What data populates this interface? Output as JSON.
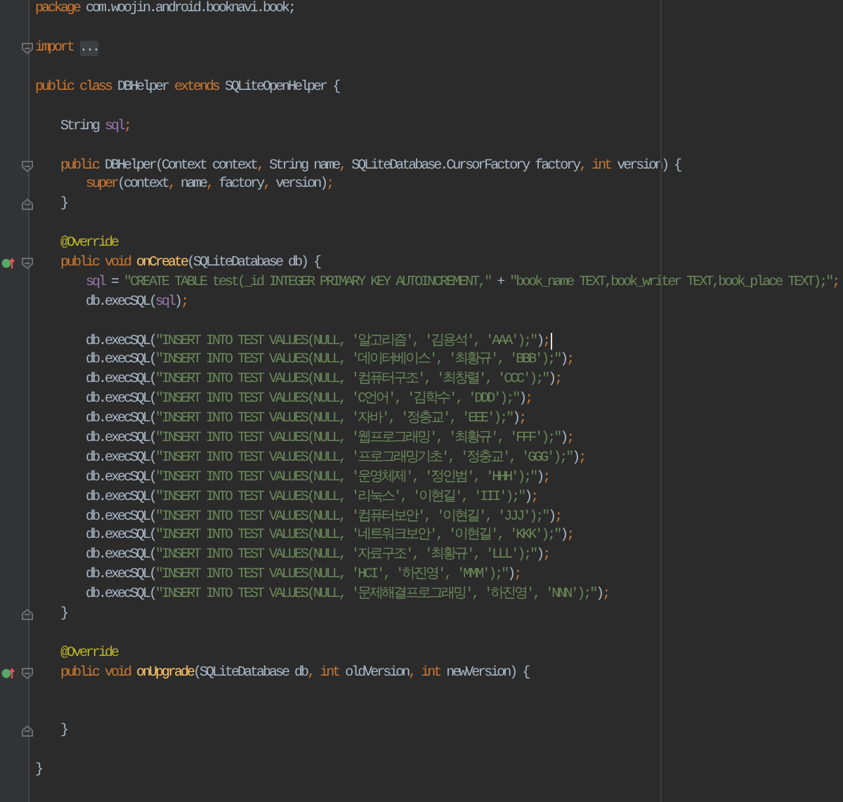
{
  "editor": {
    "lines": [
      {
        "kind": "code",
        "tokens": [
          {
            "kind": "keyword",
            "text": "package"
          },
          {
            "kind": "plain",
            "text": " com.woojin.android.booknavi.book;"
          }
        ]
      },
      {
        "kind": "blank"
      },
      {
        "kind": "code",
        "fold_open": true,
        "tokens": [
          {
            "kind": "keyword",
            "text": "import "
          },
          {
            "kind": "folded",
            "text": "..."
          }
        ]
      },
      {
        "kind": "blank"
      },
      {
        "kind": "code",
        "tokens": [
          {
            "kind": "keyword",
            "text": "public class "
          },
          {
            "kind": "plain",
            "text": "DBHelper "
          },
          {
            "kind": "keyword",
            "text": "extends "
          },
          {
            "kind": "plain",
            "text": "SQLiteOpenHelper {"
          }
        ]
      },
      {
        "kind": "blank"
      },
      {
        "kind": "code",
        "tokens": [
          {
            "kind": "plain",
            "text": "    String "
          },
          {
            "kind": "field",
            "text": "sql"
          },
          {
            "kind": "keyword",
            "text": ";"
          }
        ]
      },
      {
        "kind": "blank"
      },
      {
        "kind": "code",
        "fold_open": true,
        "tokens": [
          {
            "kind": "keyword",
            "text": "    public "
          },
          {
            "kind": "plain",
            "text": "DBHelper(Context context"
          },
          {
            "kind": "keyword",
            "text": ", "
          },
          {
            "kind": "plain",
            "text": "String name"
          },
          {
            "kind": "keyword",
            "text": ", "
          },
          {
            "kind": "plain",
            "text": "SQLiteDatabase.CursorFactory factory"
          },
          {
            "kind": "keyword",
            "text": ", int "
          },
          {
            "kind": "plain",
            "text": "version) {"
          }
        ]
      },
      {
        "kind": "code",
        "tokens": [
          {
            "kind": "keyword",
            "text": "        super"
          },
          {
            "kind": "plain",
            "text": "(context"
          },
          {
            "kind": "keyword",
            "text": ", "
          },
          {
            "kind": "plain",
            "text": "name"
          },
          {
            "kind": "keyword",
            "text": ", "
          },
          {
            "kind": "plain",
            "text": "factory"
          },
          {
            "kind": "keyword",
            "text": ", "
          },
          {
            "kind": "plain",
            "text": "version)"
          },
          {
            "kind": "keyword",
            "text": ";"
          }
        ]
      },
      {
        "kind": "code",
        "fold_close": true,
        "tokens": [
          {
            "kind": "plain",
            "text": "    }"
          }
        ]
      },
      {
        "kind": "blank"
      },
      {
        "kind": "code",
        "tokens": [
          {
            "kind": "annotation",
            "text": "    @Override"
          }
        ]
      },
      {
        "kind": "code",
        "fold_open": true,
        "override": true,
        "tokens": [
          {
            "kind": "keyword",
            "text": "    public void "
          },
          {
            "kind": "method",
            "text": "onCreate"
          },
          {
            "kind": "plain",
            "text": "(SQLiteDatabase db) {"
          }
        ]
      },
      {
        "kind": "code",
        "tokens": [
          {
            "kind": "field",
            "text": "        sql"
          },
          {
            "kind": "plain",
            "text": " = "
          },
          {
            "kind": "string",
            "text": "\"CREATE TABLE test(_id INTEGER PRIMARY KEY AUTOINCREMENT,\""
          },
          {
            "kind": "plain",
            "text": " + "
          },
          {
            "kind": "string",
            "text": "\"book_name TEXT,book_writer TEXT,book_place TEXT);\""
          },
          {
            "kind": "keyword",
            "text": ";"
          }
        ]
      },
      {
        "kind": "code",
        "tokens": [
          {
            "kind": "plain",
            "text": "        db.execSQL("
          },
          {
            "kind": "field",
            "text": "sql"
          },
          {
            "kind": "plain",
            "text": ")"
          },
          {
            "kind": "keyword",
            "text": ";"
          }
        ]
      },
      {
        "kind": "blank"
      },
      {
        "kind": "code",
        "cursor": true,
        "tokens": [
          {
            "kind": "plain",
            "text": "        db.execSQL("
          },
          {
            "kind": "string",
            "text": "\"INSERT INTO TEST VALUES(NULL, '알고리즘', '김용석', 'AAA');\""
          },
          {
            "kind": "plain",
            "text": ")"
          },
          {
            "kind": "keyword",
            "text": ";"
          }
        ]
      },
      {
        "kind": "code",
        "tokens": [
          {
            "kind": "plain",
            "text": "        db.execSQL("
          },
          {
            "kind": "string",
            "text": "\"INSERT INTO TEST VALUES(NULL, '데이터베이스', '최황규', 'BBB');\""
          },
          {
            "kind": "plain",
            "text": ")"
          },
          {
            "kind": "keyword",
            "text": ";"
          }
        ]
      },
      {
        "kind": "code",
        "tokens": [
          {
            "kind": "plain",
            "text": "        db.execSQL("
          },
          {
            "kind": "string",
            "text": "\"INSERT INTO TEST VALUES(NULL, '컴퓨터구조', '최창렬', 'CCC');\""
          },
          {
            "kind": "plain",
            "text": ")"
          },
          {
            "kind": "keyword",
            "text": ";"
          }
        ]
      },
      {
        "kind": "code",
        "tokens": [
          {
            "kind": "plain",
            "text": "        db.execSQL("
          },
          {
            "kind": "string",
            "text": "\"INSERT INTO TEST VALUES(NULL, 'C언어', '김학수', 'DDD');\""
          },
          {
            "kind": "plain",
            "text": ")"
          },
          {
            "kind": "keyword",
            "text": ";"
          }
        ]
      },
      {
        "kind": "code",
        "tokens": [
          {
            "kind": "plain",
            "text": "        db.execSQL("
          },
          {
            "kind": "string",
            "text": "\"INSERT INTO TEST VALUES(NULL, '자바', '정충교', 'EEE');\""
          },
          {
            "kind": "plain",
            "text": ")"
          },
          {
            "kind": "keyword",
            "text": ";"
          }
        ]
      },
      {
        "kind": "code",
        "tokens": [
          {
            "kind": "plain",
            "text": "        db.execSQL("
          },
          {
            "kind": "string",
            "text": "\"INSERT INTO TEST VALUES(NULL, '웹프로그래밍', '최황규', 'FFF');\""
          },
          {
            "kind": "plain",
            "text": ")"
          },
          {
            "kind": "keyword",
            "text": ";"
          }
        ]
      },
      {
        "kind": "code",
        "tokens": [
          {
            "kind": "plain",
            "text": "        db.execSQL("
          },
          {
            "kind": "string",
            "text": "\"INSERT INTO TEST VALUES(NULL, '프로그래밍기초', '정충교', 'GGG');\""
          },
          {
            "kind": "plain",
            "text": ")"
          },
          {
            "kind": "keyword",
            "text": ";"
          }
        ]
      },
      {
        "kind": "code",
        "tokens": [
          {
            "kind": "plain",
            "text": "        db.execSQL("
          },
          {
            "kind": "string",
            "text": "\"INSERT INTO TEST VALUES(NULL, '운영체제', '정인범', 'HHH');\""
          },
          {
            "kind": "plain",
            "text": ")"
          },
          {
            "kind": "keyword",
            "text": ";"
          }
        ]
      },
      {
        "kind": "code",
        "tokens": [
          {
            "kind": "plain",
            "text": "        db.execSQL("
          },
          {
            "kind": "string",
            "text": "\"INSERT INTO TEST VALUES(NULL, '리눅스', '이현길', 'III');\""
          },
          {
            "kind": "plain",
            "text": ")"
          },
          {
            "kind": "keyword",
            "text": ";"
          }
        ]
      },
      {
        "kind": "code",
        "tokens": [
          {
            "kind": "plain",
            "text": "        db.execSQL("
          },
          {
            "kind": "string",
            "text": "\"INSERT INTO TEST VALUES(NULL, '컴퓨터보안', '이현길', 'JJJ');\""
          },
          {
            "kind": "plain",
            "text": ")"
          },
          {
            "kind": "keyword",
            "text": ";"
          }
        ]
      },
      {
        "kind": "code",
        "tokens": [
          {
            "kind": "plain",
            "text": "        db.execSQL("
          },
          {
            "kind": "string",
            "text": "\"INSERT INTO TEST VALUES(NULL, '네트워크보안', '이현길', 'KKK');\""
          },
          {
            "kind": "plain",
            "text": ")"
          },
          {
            "kind": "keyword",
            "text": ";"
          }
        ]
      },
      {
        "kind": "code",
        "tokens": [
          {
            "kind": "plain",
            "text": "        db.execSQL("
          },
          {
            "kind": "string",
            "text": "\"INSERT INTO TEST VALUES(NULL, '자료구조', '최황규', 'LLL');\""
          },
          {
            "kind": "plain",
            "text": ")"
          },
          {
            "kind": "keyword",
            "text": ";"
          }
        ]
      },
      {
        "kind": "code",
        "tokens": [
          {
            "kind": "plain",
            "text": "        db.execSQL("
          },
          {
            "kind": "string",
            "text": "\"INSERT INTO TEST VALUES(NULL, 'HCI', '하진영', 'MMM');\""
          },
          {
            "kind": "plain",
            "text": ")"
          },
          {
            "kind": "keyword",
            "text": ";"
          }
        ]
      },
      {
        "kind": "code",
        "tokens": [
          {
            "kind": "plain",
            "text": "        db.execSQL("
          },
          {
            "kind": "string",
            "text": "\"INSERT INTO TEST VALUES(NULL, '문제해결프로그래밍', '하진영', 'NNN');\""
          },
          {
            "kind": "plain",
            "text": ")"
          },
          {
            "kind": "keyword",
            "text": ";"
          }
        ]
      },
      {
        "kind": "code",
        "fold_close": true,
        "tokens": [
          {
            "kind": "plain",
            "text": "    }"
          }
        ]
      },
      {
        "kind": "blank"
      },
      {
        "kind": "code",
        "tokens": [
          {
            "kind": "annotation",
            "text": "    @Override"
          }
        ]
      },
      {
        "kind": "code",
        "fold_open": true,
        "override": true,
        "tokens": [
          {
            "kind": "keyword",
            "text": "    public void "
          },
          {
            "kind": "method",
            "text": "onUpgrade"
          },
          {
            "kind": "plain",
            "text": "(SQLiteDatabase db"
          },
          {
            "kind": "keyword",
            "text": ", int "
          },
          {
            "kind": "plain",
            "text": "oldVersion"
          },
          {
            "kind": "keyword",
            "text": ", int "
          },
          {
            "kind": "plain",
            "text": "newVersion) {"
          }
        ]
      },
      {
        "kind": "blank"
      },
      {
        "kind": "blank"
      },
      {
        "kind": "code",
        "fold_close": true,
        "tokens": [
          {
            "kind": "plain",
            "text": "    }"
          }
        ]
      },
      {
        "kind": "blank"
      },
      {
        "kind": "code",
        "tokens": [
          {
            "kind": "plain",
            "text": "}"
          }
        ]
      },
      {
        "kind": "blank"
      }
    ]
  }
}
